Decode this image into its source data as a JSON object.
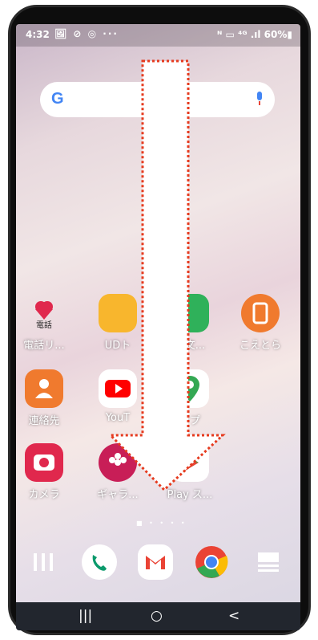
{
  "statusbar": {
    "time": "4:32",
    "left_icons": "🖼 ⊘ ◎ ···",
    "right": "ᴺ ▭ ⁴ᴳ .ıl 60%▮"
  },
  "search": {
    "logo": "G",
    "icon": "mic-icon"
  },
  "apps": [
    {
      "label": "電話リ..."
    },
    {
      "label": "UDト"
    },
    {
      "label": "声文..."
    },
    {
      "label": "こえとら"
    },
    {
      "label": "連絡先"
    },
    {
      "label": "YouT"
    },
    {
      "label": "ップ"
    },
    {
      "label": "カメラ"
    },
    {
      "label": "ギャラ..."
    },
    {
      "label": "Play ス..."
    }
  ],
  "dock": [
    "apps-drawer-icon",
    "phone-icon",
    "gmail-icon",
    "chrome-icon",
    "news-icon"
  ],
  "page_dots": "■ • • • •",
  "nav": {
    "recent": "|||",
    "home": "○",
    "back": "<"
  },
  "colors": {
    "accent_arrow": "#e63a1e",
    "orange_app": "#f07a2e",
    "red_app": "#e0284d",
    "nav": "#22262e"
  }
}
